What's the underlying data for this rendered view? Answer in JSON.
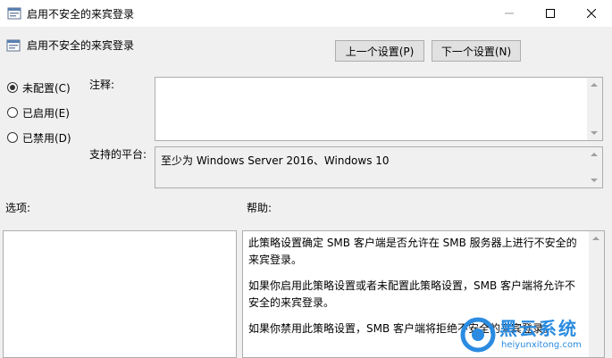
{
  "window": {
    "title": "启用不安全的来宾登录",
    "controls": {
      "minimize": "—",
      "maximize": "☐",
      "close": "✕"
    }
  },
  "header": {
    "policy_name": "启用不安全的来宾登录",
    "prev_button": "上一个设置(P)",
    "next_button": "下一个设置(N)"
  },
  "options": {
    "items": [
      {
        "label": "未配置(C)",
        "checked": true
      },
      {
        "label": "已启用(E)",
        "checked": false
      },
      {
        "label": "已禁用(D)",
        "checked": false
      }
    ]
  },
  "comment": {
    "label": "注释:",
    "value": ""
  },
  "platform": {
    "label": "支持的平台:",
    "value": "至少为 Windows Server 2016、Windows 10"
  },
  "sections": {
    "options_label": "选项:",
    "help_label": "帮助:"
  },
  "help": {
    "paragraphs": [
      "此策略设置确定 SMB 客户端是否允许在 SMB 服务器上进行不安全的来宾登录。",
      "如果你启用此策略设置或者未配置此策略设置，SMB 客户端将允许不安全的来宾登录。",
      "如果你禁用此策略设置，SMB 客户端将拒绝不安全的来宾登录。"
    ]
  },
  "watermark": {
    "brand": "黑云系统",
    "site": "heiyunxitong.com"
  },
  "colors": {
    "accent": "#2a8be0",
    "window_bg": "#f0f0f0",
    "border": "#adadad"
  }
}
